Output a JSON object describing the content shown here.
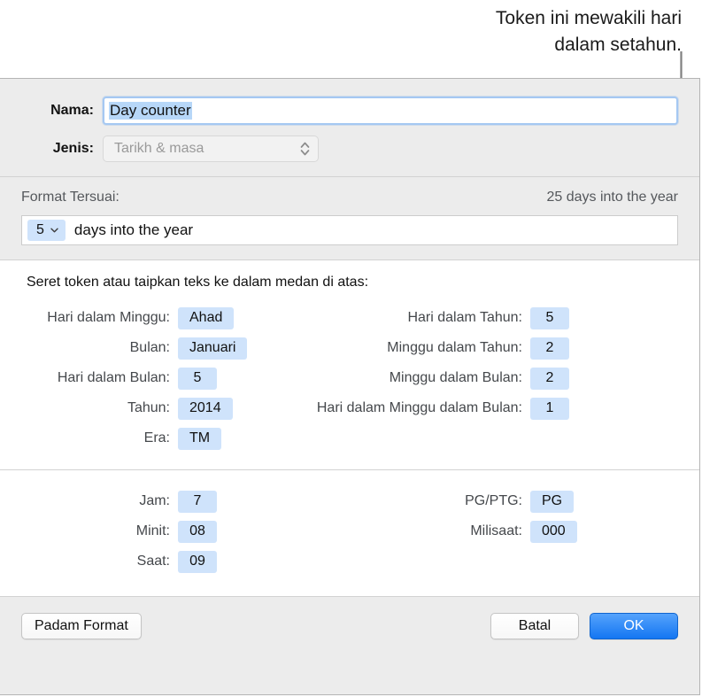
{
  "callout": {
    "text": "Token ini mewakili hari\ndalam setahun.",
    "line_color": "#808080"
  },
  "dialog": {
    "name_row": {
      "label": "Nama:",
      "value": "Day counter",
      "selected": true
    },
    "kind_row": {
      "label": "Jenis:",
      "value": "Tarikh & masa",
      "stepper_icon": "chevron-up-down-icon"
    },
    "format_section": {
      "label": "Format Tersuai:",
      "preview": "25 days into the year",
      "field": {
        "token_value": "5",
        "token_icon": "chevron-down-icon",
        "text": "days into the year"
      }
    },
    "date_section": {
      "hint": "Seret token atau taipkan teks ke dalam medan di atas:",
      "left_column": [
        {
          "label": "Hari dalam Minggu:",
          "value": "Ahad"
        },
        {
          "label": "Bulan:",
          "value": "Januari"
        },
        {
          "label": "Hari dalam Bulan:",
          "value": "5"
        },
        {
          "label": "Tahun:",
          "value": "2014"
        },
        {
          "label": "Era:",
          "value": "TM"
        }
      ],
      "right_column": [
        {
          "label": "Hari dalam Tahun:",
          "value": "5"
        },
        {
          "label": "Minggu dalam Tahun:",
          "value": "2"
        },
        {
          "label": "Minggu dalam Bulan:",
          "value": "2"
        },
        {
          "label": "Hari dalam Minggu dalam Bulan:",
          "value": "1"
        }
      ]
    },
    "time_section": {
      "left_column": [
        {
          "label": "Jam:",
          "value": "7"
        },
        {
          "label": "Minit:",
          "value": "08"
        },
        {
          "label": "Saat:",
          "value": "09"
        }
      ],
      "right_column": [
        {
          "label": "PG/PTG:",
          "value": "PG"
        },
        {
          "label": "Milisaat:",
          "value": "000"
        }
      ]
    },
    "footer": {
      "delete_format_label": "Padam Format",
      "cancel_label": "Batal",
      "ok_label": "OK"
    }
  },
  "colors": {
    "token_bg": "#cfe3fb",
    "ok_button": "#1476f2",
    "panel_gray": "#ececec",
    "selection_blue": "#b7d7f8"
  }
}
